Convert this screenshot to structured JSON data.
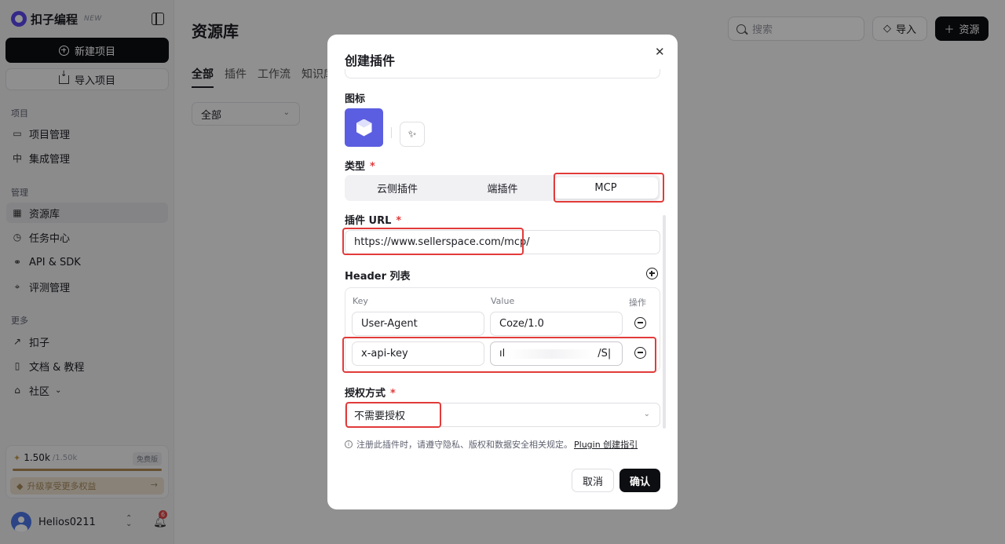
{
  "sidebar": {
    "logo_text": "扣子编程",
    "logo_badge": "NEW",
    "new_project": "新建项目",
    "import_project": "导入项目",
    "sections": {
      "project": "项目",
      "manage": "管理",
      "more": "更多"
    },
    "project_items": [
      {
        "label": "项目管理",
        "icon": "folder-icon"
      },
      {
        "label": "集成管理",
        "icon": "integration-icon"
      }
    ],
    "manage_items": [
      {
        "label": "资源库",
        "icon": "grid-icon"
      },
      {
        "label": "任务中心",
        "icon": "clock-icon"
      },
      {
        "label": "API & SDK",
        "icon": "api-icon"
      },
      {
        "label": "评测管理",
        "icon": "telescope-icon"
      }
    ],
    "more_items": [
      {
        "label": "扣子",
        "icon": "arrow-up-right-icon"
      },
      {
        "label": "文档 & 教程",
        "icon": "book-icon"
      },
      {
        "label": "社区",
        "icon": "community-icon"
      }
    ],
    "quota": {
      "used": "1.50k",
      "total": "/1.50k",
      "tag": "免费版",
      "fill_fraction": 1.0,
      "upgrade": "升级享受更多权益"
    },
    "user": {
      "name": "Helios0211",
      "notifications": "6"
    }
  },
  "main": {
    "title": "资源库",
    "tabs": [
      "全部",
      "插件",
      "工作流",
      "知识库"
    ],
    "filter_value": "全部",
    "search_placeholder": "搜索",
    "import_label": "导入",
    "resource_label": "资源"
  },
  "modal": {
    "title": "创建插件",
    "icon_label": "图标",
    "type_label": "类型",
    "type_options": [
      "云侧插件",
      "端插件",
      "MCP"
    ],
    "type_selected": "MCP",
    "url_label": "插件 URL",
    "url_value": "https://www.sellerspace.com/mcp/",
    "header_label": "Header 列表",
    "header_columns": {
      "key": "Key",
      "value": "Value",
      "action": "操作"
    },
    "headers": [
      {
        "key": "User-Agent",
        "value": "Coze/1.0"
      },
      {
        "key": "x-api-key",
        "value_start": "ıl",
        "value_end": "/S|"
      }
    ],
    "auth_label": "授权方式",
    "auth_value": "不需要授权",
    "notice_text": "注册此插件时，请遵守隐私、版权和数据安全相关规定。",
    "notice_link": "Plugin 创建指引",
    "cancel": "取消",
    "confirm": "确认"
  },
  "colors": {
    "highlight": "#e23b3b",
    "primary_dark": "#0d0e12",
    "icon_tile": "#5b5ee0"
  }
}
